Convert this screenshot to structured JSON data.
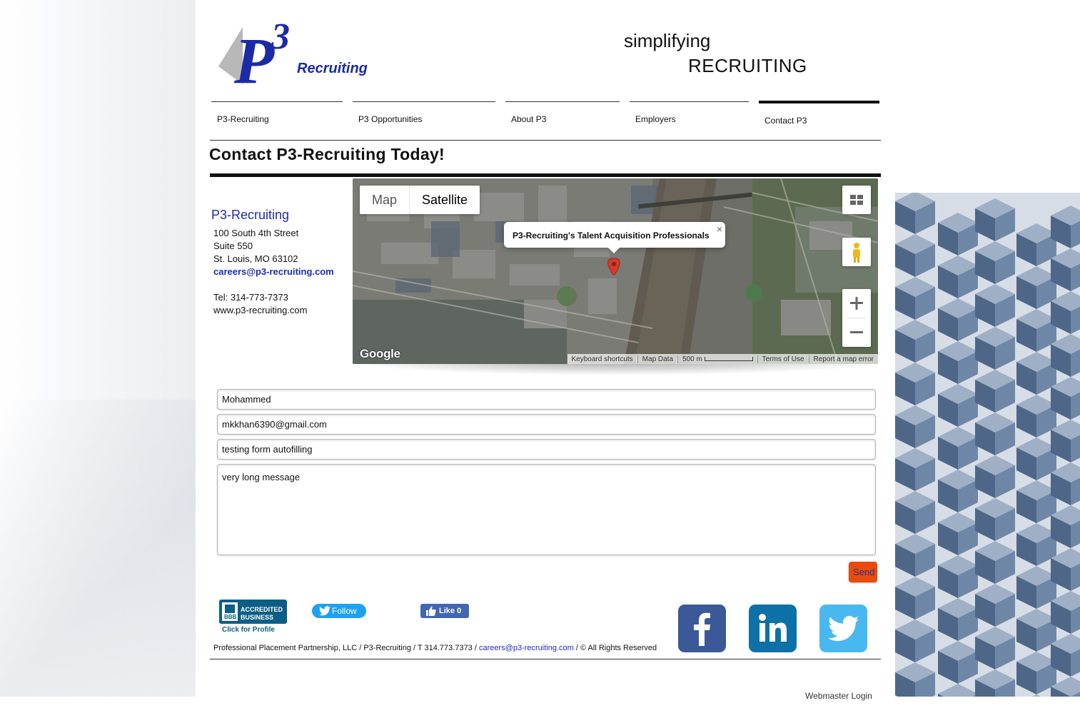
{
  "header": {
    "logo_text": "P3 Recruiting",
    "tagline_line1": "simplifying",
    "tagline_line2": "RECRUITING"
  },
  "nav": {
    "items": [
      {
        "label": "P3-Recruiting"
      },
      {
        "label": "P3 Opportunities"
      },
      {
        "label": "About P3"
      },
      {
        "label": "Employers"
      },
      {
        "label": "Contact P3",
        "active": true
      }
    ]
  },
  "page_title": "Contact P3-Recruiting Today!",
  "address": {
    "company": "P3-Recruiting",
    "street": "100 South 4th Street",
    "suite": "Suite 550",
    "city": "St. Louis, MO 63102",
    "email": "careers@p3-recruiting.com",
    "tel": "Tel: 314-773-7373",
    "website": "www.p3-recruiting.com"
  },
  "map": {
    "type_map": "Map",
    "type_satellite": "Satellite",
    "selected_type": "Satellite",
    "infowindow": "P3-Recruiting's Talent Acquisition Professionals",
    "close": "×",
    "brand": "Google",
    "footer": {
      "shortcuts": "Keyboard shortcuts",
      "data": "Map Data",
      "scale": "500 m",
      "terms": "Terms of Use",
      "report": "Report a map error"
    }
  },
  "form": {
    "name_value": "Mohammed",
    "email_value": "mkkhan6390@gmail.com",
    "subject_value": "testing form autofilling",
    "message_value": "very long message",
    "send_label": "Send"
  },
  "social": {
    "bbb_line1": "ACCREDITED",
    "bbb_line2": "BUSINESS",
    "bbb_brand": "BBB",
    "bbb_cta": "Click for Profile",
    "twitter_follow": "Follow",
    "fb_like": "Like 0"
  },
  "footer": {
    "text_before": "Professional Placement Partnership, LLC /  P3-Recruiting / T 314.773.7373 / ",
    "email": "careers@p3-recruiting.com",
    "text_after": " / © All Rights Reserved",
    "webmaster": "Webmaster Login"
  },
  "colors": {
    "link_blue": "#1e2ac0",
    "send_orange": "#e84b0c",
    "facebook": "#3b5998",
    "linkedin": "#0d71a8",
    "twitter": "#4ab8f0"
  }
}
